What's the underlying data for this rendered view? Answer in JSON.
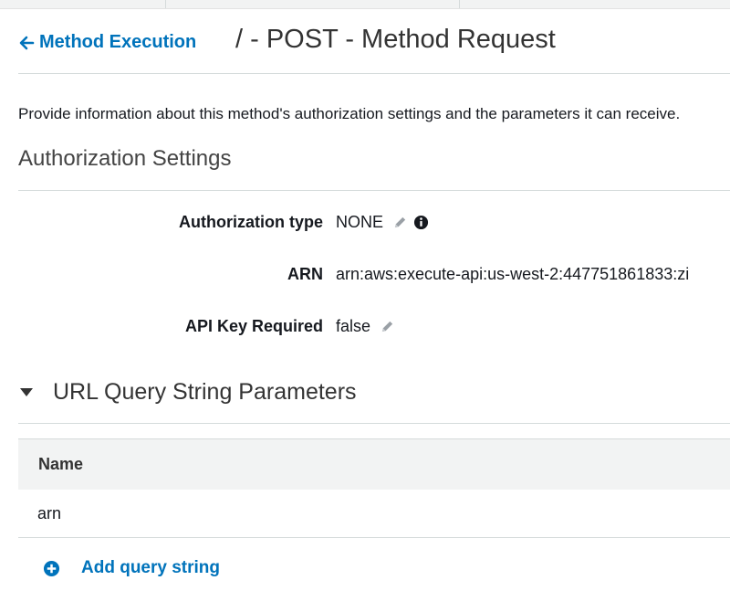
{
  "header": {
    "back_label": "Method Execution",
    "title": "/ - POST - Method Request"
  },
  "description": "Provide information about this method's authorization settings and the parameters it can receive.",
  "authorization": {
    "section_title": "Authorization Settings",
    "auth_type_label": "Authorization type",
    "auth_type_value": "NONE",
    "arn_label": "ARN",
    "arn_value": "arn:aws:execute-api:us-west-2:447751861833:zi",
    "api_key_label": "API Key Required",
    "api_key_value": "false"
  },
  "query_strings": {
    "section_title": "URL Query String Parameters",
    "column_name": "Name",
    "rows": [
      {
        "name": "arn"
      }
    ],
    "add_label": "Add query string"
  },
  "colors": {
    "link": "#0073bb",
    "border": "#d5dbdb",
    "table_header_bg": "#f2f3f3"
  },
  "icons": {
    "back": "arrow-left-icon",
    "edit": "pencil-icon",
    "info": "info-icon",
    "collapse": "caret-down-icon",
    "add": "plus-circle-icon"
  }
}
